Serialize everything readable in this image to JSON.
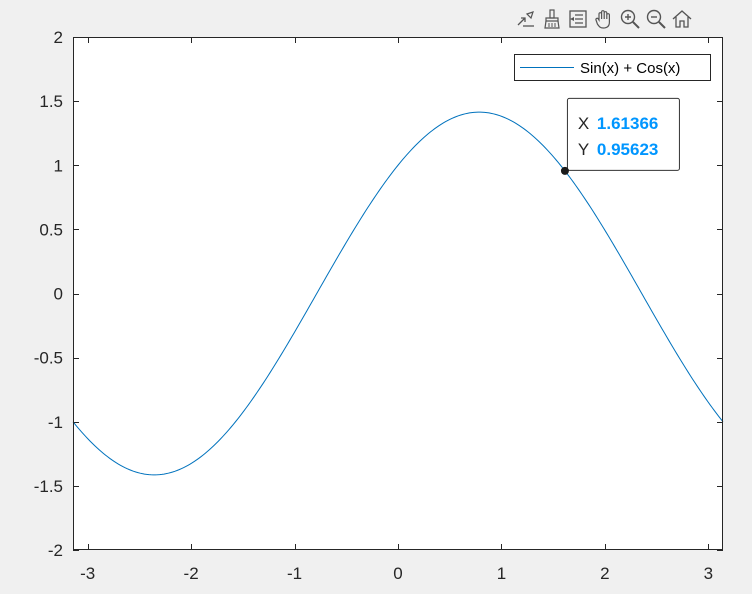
{
  "toolbar": {
    "buttons": [
      {
        "name": "export-icon"
      },
      {
        "name": "brush-icon"
      },
      {
        "name": "data-tips-icon"
      },
      {
        "name": "pan-hand-icon"
      },
      {
        "name": "zoom-in-icon"
      },
      {
        "name": "zoom-out-icon"
      },
      {
        "name": "home-icon"
      }
    ]
  },
  "colors": {
    "background": "#f0f0f0",
    "axes_bg": "#ffffff",
    "line": "#0072bd",
    "datatip_value": "#0096ff"
  },
  "datatip": {
    "x_label": "X",
    "y_label": "Y",
    "x_value": "1.61366",
    "y_value": "0.95623",
    "x": 1.61366,
    "y": 0.95623
  },
  "chart_data": {
    "type": "line",
    "function": "sin(x) + cos(x)",
    "xlim": [
      -3.14159,
      3.14159
    ],
    "ylim": [
      -2,
      2
    ],
    "x_ticks": [
      -3,
      -2,
      -1,
      0,
      1,
      2,
      3
    ],
    "x_tick_labels": [
      "-3",
      "-2",
      "-1",
      "0",
      "1",
      "2",
      "3"
    ],
    "y_ticks": [
      2,
      1.5,
      1,
      0.5,
      0,
      -0.5,
      -1,
      -1.5,
      -2
    ],
    "y_tick_labels": [
      "2",
      "1.5",
      "1",
      "0.5",
      "0",
      "-0.5",
      "-1",
      "-1.5",
      "-2"
    ],
    "grid": false,
    "legend_position": "top-right",
    "series": [
      {
        "name": "Sin(x) + Cos(x)",
        "x": [
          -3.1416,
          -2.8274,
          -2.5133,
          -2.1991,
          -1.885,
          -1.5708,
          -1.2566,
          -0.9425,
          -0.6283,
          -0.3142,
          0,
          0.3142,
          0.6283,
          0.9425,
          1.2566,
          1.5708,
          1.885,
          2.1991,
          2.5133,
          2.8274,
          3.1416
        ],
        "y": [
          -1.0,
          -1.2601,
          -1.3968,
          -1.3968,
          -1.2601,
          -1.0,
          -0.642,
          -0.2212,
          0.2212,
          0.642,
          1.0,
          1.2601,
          1.3968,
          1.3968,
          1.2601,
          1.0,
          0.642,
          0.2212,
          -0.2212,
          -0.642,
          -1.0
        ]
      }
    ]
  }
}
